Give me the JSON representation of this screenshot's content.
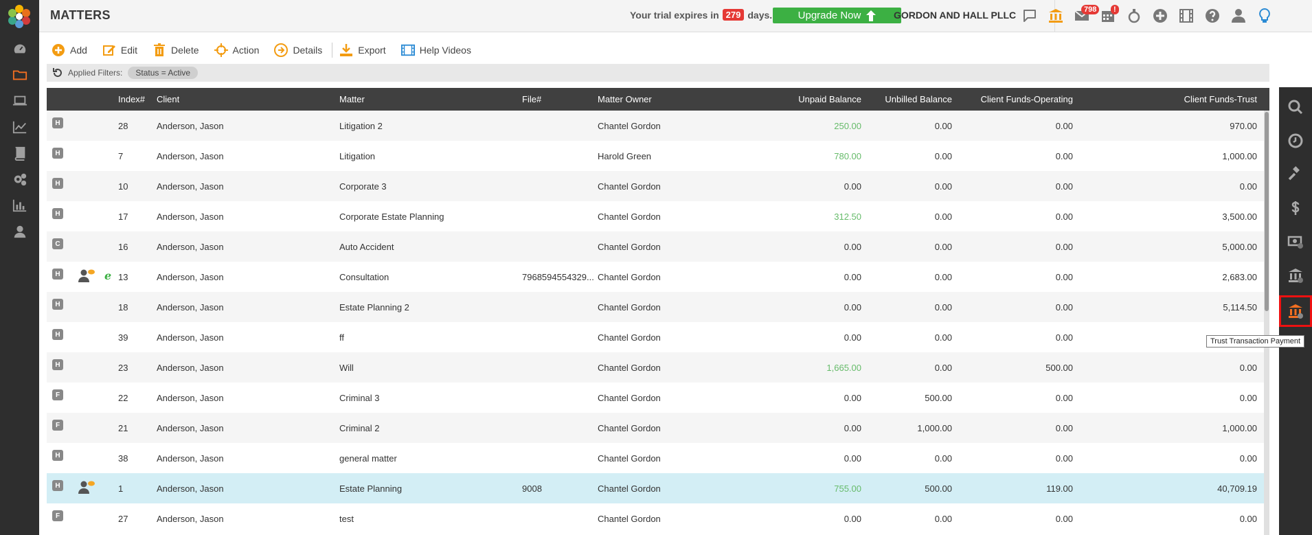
{
  "app": {
    "page_title": "MATTERS",
    "trial_prefix": "Your trial expires in",
    "trial_days": "279",
    "trial_suffix": "days.",
    "upgrade_label": "Upgrade Now",
    "firm_name": "GORDON AND HALL PLLC",
    "mail_count": "798",
    "calendar_badge": "!"
  },
  "left_nav": [
    "dashboard-icon",
    "matters-folder-icon",
    "laptop-icon",
    "trend-chart-icon",
    "book-icon",
    "gears-icon",
    "bar-chart-icon",
    "user-icon"
  ],
  "top_icons": [
    "chat-icon",
    "bank-icon",
    "mail-icon",
    "calendar-icon",
    "stopwatch-icon",
    "plus-circle-icon",
    "film-icon",
    "help-icon",
    "user-icon",
    "lightbulb-icon"
  ],
  "toolbar": {
    "add": "Add",
    "edit": "Edit",
    "delete": "Delete",
    "action": "Action",
    "details": "Details",
    "export": "Export",
    "help_videos": "Help Videos"
  },
  "filters": {
    "label": "Applied Filters:",
    "chip": "Status = Active"
  },
  "table": {
    "headers": {
      "index": "Index#",
      "client": "Client",
      "matter": "Matter",
      "file": "File#",
      "owner": "Matter Owner",
      "unpaid": "Unpaid Balance",
      "unbilled": "Unbilled Balance",
      "operating": "Client Funds-Operating",
      "trust": "Client Funds-Trust"
    },
    "rows": [
      {
        "type": "H",
        "index": "28",
        "client": "Anderson, Jason",
        "matter": "Litigation 2",
        "file": "",
        "owner": "Chantel Gordon",
        "unpaid": "250.00",
        "unbilled": "0.00",
        "operating": "0.00",
        "trust": "970.00"
      },
      {
        "type": "H",
        "index": "7",
        "client": "Anderson, Jason",
        "matter": "Litigation",
        "file": "",
        "owner": "Harold Green",
        "unpaid": "780.00",
        "unbilled": "0.00",
        "operating": "0.00",
        "trust": "1,000.00"
      },
      {
        "type": "H",
        "index": "10",
        "client": "Anderson, Jason",
        "matter": "Corporate 3",
        "file": "",
        "owner": "Chantel Gordon",
        "unpaid": "0.00",
        "unbilled": "0.00",
        "operating": "0.00",
        "trust": "0.00"
      },
      {
        "type": "H",
        "index": "17",
        "client": "Anderson, Jason",
        "matter": "Corporate Estate Planning",
        "file": "",
        "owner": "Chantel Gordon",
        "unpaid": "312.50",
        "unbilled": "0.00",
        "operating": "0.00",
        "trust": "3,500.00"
      },
      {
        "type": "C",
        "index": "16",
        "client": "Anderson, Jason",
        "matter": "Auto Accident",
        "file": "",
        "owner": "Chantel Gordon",
        "unpaid": "0.00",
        "unbilled": "0.00",
        "operating": "0.00",
        "trust": "5,000.00"
      },
      {
        "type": "H",
        "index": "13",
        "client": "Anderson, Jason",
        "matter": "Consultation",
        "file": "7968594554329...",
        "owner": "Chantel Gordon",
        "unpaid": "0.00",
        "unbilled": "0.00",
        "operating": "0.00",
        "trust": "2,683.00"
      },
      {
        "type": "H",
        "index": "18",
        "client": "Anderson, Jason",
        "matter": "Estate Planning 2",
        "file": "",
        "owner": "Chantel Gordon",
        "unpaid": "0.00",
        "unbilled": "0.00",
        "operating": "0.00",
        "trust": "5,114.50"
      },
      {
        "type": "H",
        "index": "39",
        "client": "Anderson, Jason",
        "matter": "ff",
        "file": "",
        "owner": "Chantel Gordon",
        "unpaid": "0.00",
        "unbilled": "0.00",
        "operating": "0.00",
        "trust": ""
      },
      {
        "type": "H",
        "index": "23",
        "client": "Anderson, Jason",
        "matter": "Will",
        "file": "",
        "owner": "Chantel Gordon",
        "unpaid": "1,665.00",
        "unbilled": "0.00",
        "operating": "500.00",
        "trust": "0.00"
      },
      {
        "type": "F",
        "index": "22",
        "client": "Anderson, Jason",
        "matter": "Criminal 3",
        "file": "",
        "owner": "Chantel Gordon",
        "unpaid": "0.00",
        "unbilled": "500.00",
        "operating": "0.00",
        "trust": "0.00"
      },
      {
        "type": "F",
        "index": "21",
        "client": "Anderson, Jason",
        "matter": "Criminal 2",
        "file": "",
        "owner": "Chantel Gordon",
        "unpaid": "0.00",
        "unbilled": "1,000.00",
        "operating": "0.00",
        "trust": "1,000.00"
      },
      {
        "type": "H",
        "index": "38",
        "client": "Anderson, Jason",
        "matter": "general matter",
        "file": "",
        "owner": "Chantel Gordon",
        "unpaid": "0.00",
        "unbilled": "0.00",
        "operating": "0.00",
        "trust": "0.00"
      },
      {
        "type": "H",
        "index": "1",
        "client": "Anderson, Jason",
        "matter": "Estate Planning",
        "file": "9008",
        "owner": "Chantel Gordon",
        "unpaid": "755.00",
        "unbilled": "500.00",
        "operating": "119.00",
        "trust": "40,709.19"
      },
      {
        "type": "F",
        "index": "27",
        "client": "Anderson, Jason",
        "matter": "test",
        "file": "",
        "owner": "Chantel Gordon",
        "unpaid": "0.00",
        "unbilled": "0.00",
        "operating": "0.00",
        "trust": "0.00"
      }
    ]
  },
  "right_rail": [
    "search-icon",
    "clock-icon",
    "gavel-icon",
    "dollar-icon",
    "cash-icon",
    "bank-icon",
    "trust-payment-icon"
  ],
  "tooltip": "Trust Transaction Payment",
  "colors": {
    "accent_orange": "#f39c12",
    "positive_green": "#66bb6a",
    "badge_red": "#e53935",
    "upgrade_green": "#3cb043",
    "nav_dark": "#2e2e2e",
    "header_dark": "#404040"
  }
}
